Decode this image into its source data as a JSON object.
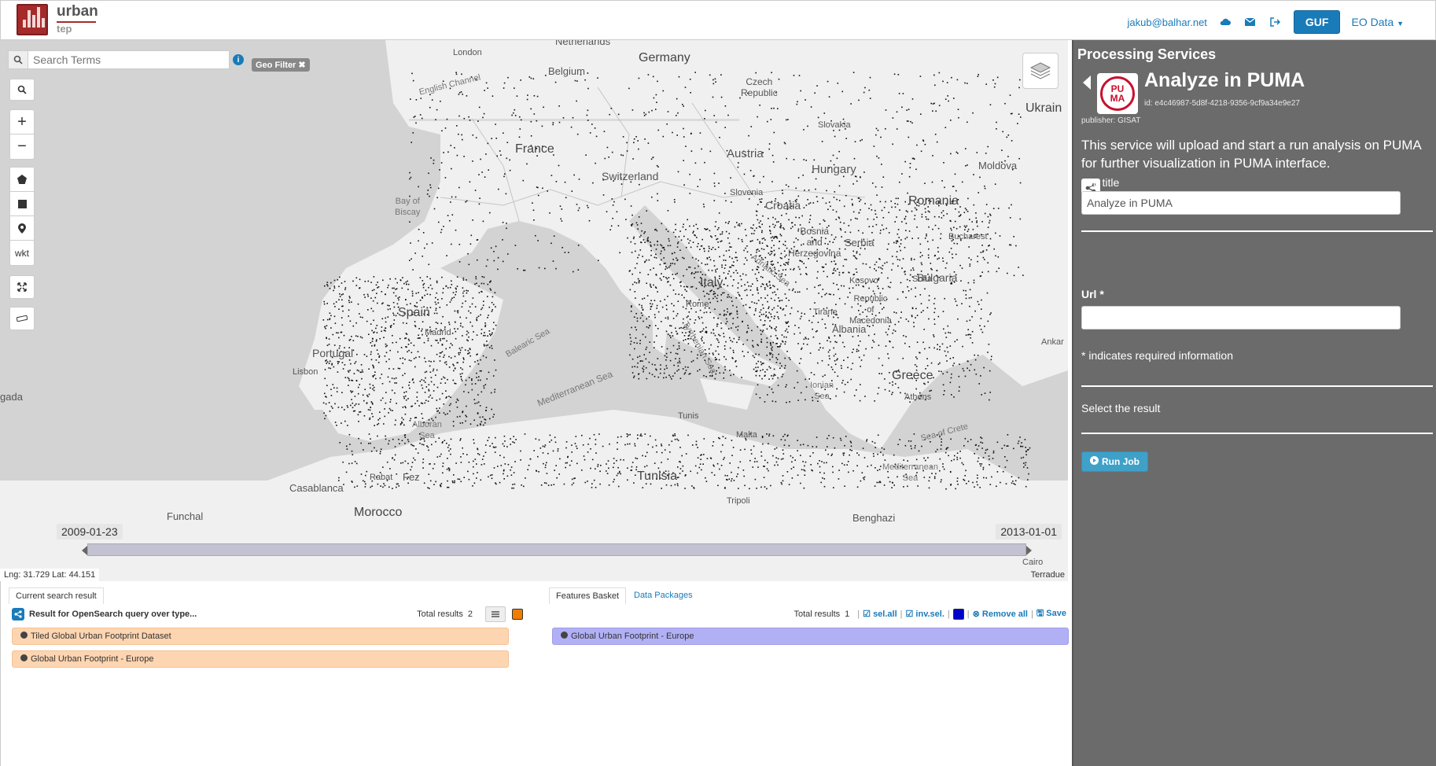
{
  "header": {
    "logo_line1": "urban",
    "logo_line2": "tep",
    "user_email": "jakub@balhar.net",
    "icons": [
      "cloud-icon",
      "envelope-icon",
      "sign-out-icon"
    ],
    "guf_label": "GUF",
    "eo_data_label": "EO Data"
  },
  "map": {
    "search_placeholder": "Search Terms",
    "info_label": "i",
    "geo_filter_label": "Geo Filter",
    "controls": {
      "zoom_in": "+",
      "zoom_out": "−",
      "wkt_label": "wkt"
    },
    "labels": {
      "netherlands": "Netherlands",
      "london": "London",
      "germany": "Germany",
      "belgium": "Belgium",
      "english_channel": "English Channel",
      "czech_republic": "Czech\nRepublic",
      "ukraine": "Ukrain",
      "france": "France",
      "austria": "Austria",
      "slovakia": "Slovakia",
      "hungary": "Hungary",
      "moldova": "Moldova",
      "switzerland": "Switzerland",
      "slovenia": "Slovenia",
      "croatia": "Croatia",
      "romania": "Romania",
      "bay_of_biscay": "Bay of\nBiscay",
      "bosnia": "Bosnia\nand\nHerzegovina",
      "serbia": "Serbia",
      "bucharest": "Bucharest",
      "adriatic_sea": "Adriatic Sea",
      "bulgaria": "Bulgaria",
      "italy": "Italy",
      "rome": "Rome",
      "kosovo": "Kosovo",
      "sofia": "Sofia",
      "republic_macedonia": "Republic\nof\nMacedonia",
      "tirane": "Tirane",
      "albania": "Albania",
      "spain": "Spain",
      "madrid": "Madrid",
      "balearic_sea": "Balearic Sea",
      "tyrrhenian_sea": "Tyrrhenian Sea",
      "ankara": "Ankar",
      "portugal": "Portugal",
      "lisbon": "Lisbon",
      "mediterranean_sea": "Mediterranean Sea",
      "ionian_sea": "Ionian\nSea",
      "greece": "Greece",
      "athens": "Athens",
      "gada": "gada",
      "tunis": "Tunis",
      "sea_of_crete": "Sea of Crete",
      "alboran_sea": "Alboran\nSea",
      "malta": "Malta",
      "casablanca": "Casablanca",
      "rabat": "Rabat",
      "fez": "Fez",
      "tunisia": "Tunisia",
      "mediterranean_sea2": "Mediterranean\nSea",
      "morocco": "Morocco",
      "tripoli": "Tripoli",
      "funchal": "Funchal",
      "benghazi": "Benghazi",
      "cairo": "Cairo"
    },
    "timeline": {
      "start_date": "2009-01-23",
      "end_date": "2013-01-01"
    },
    "coordinates": "Lng: 31.729 Lat: 44.151",
    "attribution": "Terradue"
  },
  "results": {
    "tab_current": "Current search result",
    "query_label": "Result for OpenSearch query over type...",
    "total_label": "Total results",
    "total_value": "2",
    "items": [
      "Tiled Global Urban Footprint Dataset",
      "Global Urban Footprint - Europe"
    ]
  },
  "basket": {
    "tab_features": "Features Basket",
    "tab_packages": "Data Packages",
    "total_label": "Total results",
    "total_value": "1",
    "sel_all": "sel.all",
    "inv_sel": "inv.sel.",
    "remove_all": "Remove all",
    "save": "Save",
    "items": [
      "Global Urban Footprint - Europe"
    ]
  },
  "side": {
    "title": "Processing Services",
    "logo_text_1": "PU",
    "logo_text_2": "MA",
    "service_title": "Analyze in PUMA",
    "service_id": "id: e4c46987-5d8f-4218-9356-9cf9a34e9e27",
    "publisher": "publisher: GISAT",
    "description": "This service will upload and start a run analysis on PUMA for further visualization in PUMA interface.",
    "job_title_label": "Job title",
    "job_title_value": "Analyze in PUMA",
    "url_label": "Url *",
    "url_value": "",
    "required_note": "* indicates required information",
    "select_result_label": "Select the result",
    "run_job_label": "Run Job"
  },
  "colors": {
    "accent": "#1a7bb9",
    "brand": "#a52a2a",
    "side_bg": "#6b6b6b",
    "result_orange": "#fdd5b1",
    "basket_purple": "#b2b0f5"
  }
}
